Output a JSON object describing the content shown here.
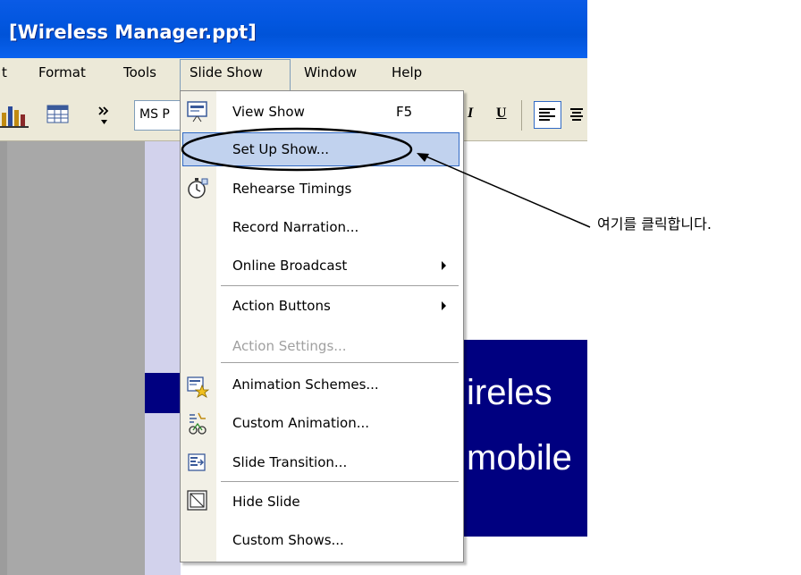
{
  "window": {
    "title": "[Wireless Manager.ppt]"
  },
  "menubar": {
    "items": [
      "t",
      "Format",
      "Tools",
      "Slide Show",
      "Window",
      "Help"
    ]
  },
  "toolbar": {
    "font_name": "MS P",
    "italic": "I",
    "underline": "U"
  },
  "dropdown": {
    "items": [
      {
        "label": "View Show",
        "shortcut": "F5",
        "icon": "view-show-icon"
      },
      {
        "label": "Set Up Show...",
        "highlighted": true
      },
      {
        "label": "Rehearse Timings",
        "icon": "stopwatch-icon"
      },
      {
        "label": "Record Narration..."
      },
      {
        "label": "Online Broadcast",
        "submenu": true
      },
      {
        "label": "Action Buttons",
        "submenu": true
      },
      {
        "label": "Action Settings...",
        "disabled": true
      },
      {
        "label": "Animation Schemes...",
        "icon": "animation-schemes-icon"
      },
      {
        "label": "Custom Animation...",
        "icon": "custom-animation-icon"
      },
      {
        "label": "Slide Transition...",
        "icon": "slide-transition-icon"
      },
      {
        "label": "Hide Slide",
        "icon": "hide-slide-icon"
      },
      {
        "label": "Custom Shows..."
      }
    ]
  },
  "slide": {
    "line1": "ireles",
    "line2": "mobile"
  },
  "annotation": {
    "text": "여기를 클릭합니다."
  },
  "colors": {
    "title_bar": "#0053d8",
    "menu_bg": "#ece9d8",
    "highlight": "#c1d2ee",
    "slide_blue": "#000080"
  }
}
